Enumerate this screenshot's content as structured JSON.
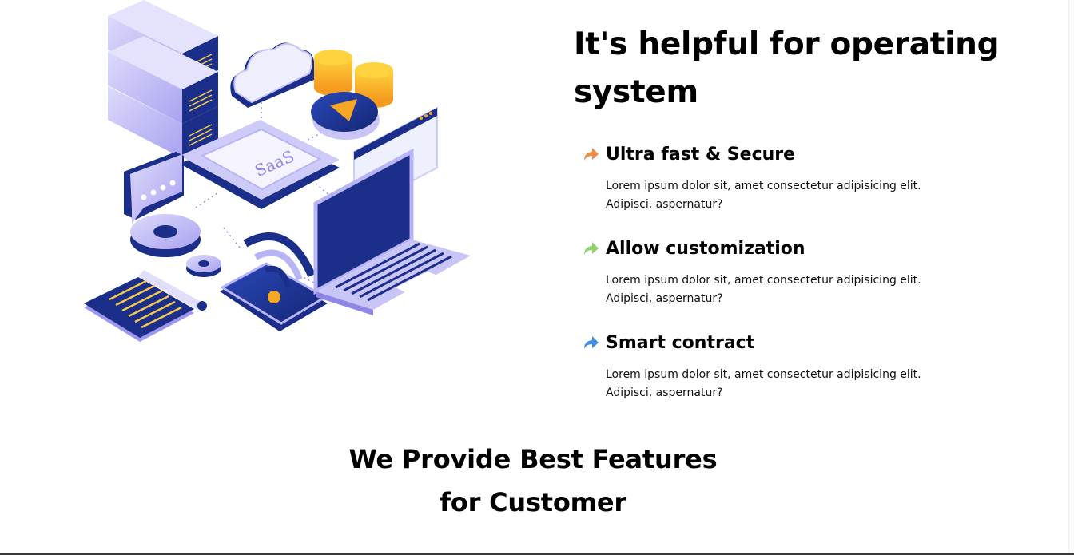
{
  "illustration": {
    "saas_label": "SaaS"
  },
  "headline": {
    "line1": "It's helpful for operating",
    "line2": "system"
  },
  "features": [
    {
      "title": "Ultra fast & Secure",
      "icon": "arrow-forward-icon",
      "icon_color": "#F08A4B",
      "desc_line1": "Lorem ipsum dolor sit, amet consectetur adipisicing elit.",
      "desc_line2": "Adipisci, aspernatur?"
    },
    {
      "title": "Allow customization",
      "icon": "arrow-forward-icon",
      "icon_color": "#8FD36F",
      "desc_line1": "Lorem ipsum dolor sit, amet consectetur adipisicing elit.",
      "desc_line2": "Adipisci, aspernatur?"
    },
    {
      "title": "Smart contract",
      "icon": "arrow-forward-icon",
      "icon_color": "#3E8EE8",
      "desc_line1": "Lorem ipsum dolor sit, amet consectetur adipisicing elit.",
      "desc_line2": "Adipisci, aspernatur?"
    }
  ],
  "section": {
    "title_line1": "We Provide Best Features",
    "title_line2": "for Customer"
  },
  "colors": {
    "navy": "#1B2F8A",
    "lavender": "#B9B4F5",
    "gold": "#F5A623",
    "orange": "#F08A4B",
    "green": "#8FD36F",
    "blue": "#3E8EE8"
  }
}
